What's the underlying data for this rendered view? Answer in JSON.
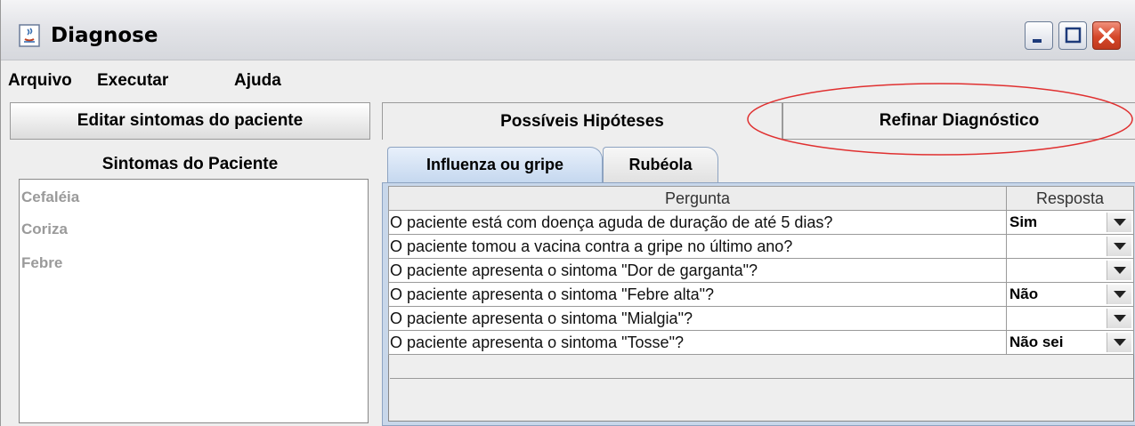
{
  "window": {
    "title": "Diagnose"
  },
  "menu": [
    "Arquivo",
    "Executar",
    "Ajuda"
  ],
  "left": {
    "edit_button": "Editar sintomas do paciente",
    "symptoms_label": "Sintomas do Paciente",
    "symptoms": [
      "Cefaléia",
      "Coriza",
      "Febre"
    ]
  },
  "tabs": {
    "hipoteses": "Possíveis Hipóteses",
    "refinar": "Refinar Diagnóstico"
  },
  "subtabs": [
    "Influenza ou gripe",
    "Rubéola"
  ],
  "table": {
    "headers": [
      "Pergunta",
      "Resposta"
    ],
    "rows": [
      {
        "question": "O paciente está com doença aguda de duração de até 5 dias?",
        "answer": "Sim"
      },
      {
        "question": "O paciente tomou a vacina contra a gripe no último ano?",
        "answer": ""
      },
      {
        "question": "O paciente apresenta o sintoma \"Dor de garganta\"?",
        "answer": ""
      },
      {
        "question": "O paciente apresenta o sintoma \"Febre alta\"?",
        "answer": "Não"
      },
      {
        "question": "O paciente apresenta o sintoma \"Mialgia\"?",
        "answer": ""
      },
      {
        "question": "O paciente apresenta o sintoma \"Tosse\"?",
        "answer": "Não sei"
      }
    ]
  },
  "colors": {
    "annotation": "#e03030",
    "selected_tab": "#c5d8ef",
    "close_button": "#d5482a"
  }
}
